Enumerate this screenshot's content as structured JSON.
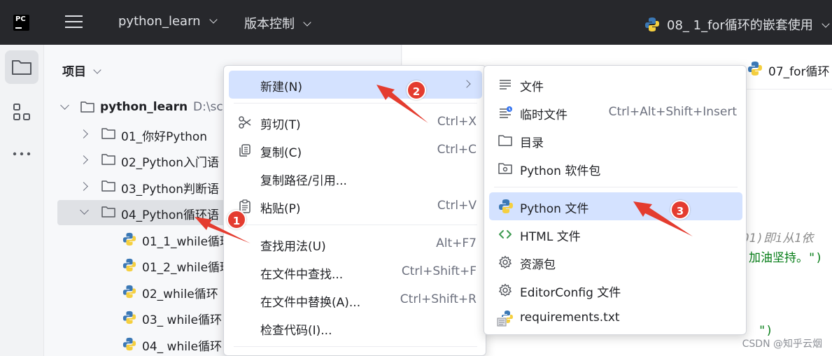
{
  "titlebar": {
    "logo_text": "PC",
    "project_name": "python_learn",
    "vcs_label": "版本控制",
    "run_config": "08_ 1_for循环的嵌套使用"
  },
  "project_panel": {
    "title": "项目",
    "root": {
      "name": "python_learn",
      "path": "D:\\sc"
    },
    "folders": [
      {
        "label": "01_你好Python",
        "expanded": false
      },
      {
        "label": "02_Python入门语",
        "expanded": false
      },
      {
        "label": "03_Python判断语",
        "expanded": false
      },
      {
        "label": "04_Python循环语",
        "expanded": true
      }
    ],
    "files": [
      "01_1_while循环",
      "01_2_while循环",
      "02_while循环",
      "03_ while循环",
      "04_ while循环"
    ]
  },
  "editor": {
    "tabs": [
      "07_for循环"
    ],
    "code_fragments": [
      ".01)即i从1依",
      "加油坚持。\")",
      "\")"
    ]
  },
  "context_menu": {
    "items": [
      {
        "label": "新建(N)",
        "mnemonic": "N",
        "shortcut": "",
        "submenu": true,
        "highlighted": true
      },
      {
        "label": "剪切(T)",
        "mnemonic": "T",
        "shortcut": "Ctrl+X",
        "icon": "scissors-icon"
      },
      {
        "label": "复制(C)",
        "mnemonic": "C",
        "shortcut": "Ctrl+C",
        "icon": "copy-icon"
      },
      {
        "label": "复制路径/引用...",
        "shortcut": ""
      },
      {
        "label": "粘贴(P)",
        "mnemonic": "P",
        "shortcut": "Ctrl+V",
        "icon": "paste-icon"
      },
      {
        "label": "查找用法(U)",
        "mnemonic": "U",
        "shortcut": "Alt+F7"
      },
      {
        "label": "在文件中查找...",
        "shortcut": "Ctrl+Shift+F"
      },
      {
        "label": "在文件中替换(A)...",
        "mnemonic": "A",
        "shortcut": "Ctrl+Shift+R"
      },
      {
        "label": "检查代码(I)...",
        "mnemonic": "I",
        "shortcut": ""
      }
    ]
  },
  "new_submenu": {
    "items": [
      {
        "label": "文件",
        "shortcut": "",
        "icon": "text-file-icon"
      },
      {
        "label": "临时文件",
        "shortcut": "Ctrl+Alt+Shift+Insert",
        "icon": "scratch-file-icon"
      },
      {
        "label": "目录",
        "shortcut": "",
        "icon": "folder-icon"
      },
      {
        "label": "Python 软件包",
        "shortcut": "",
        "icon": "package-icon"
      },
      {
        "label": "Python 文件",
        "shortcut": "",
        "icon": "python-icon",
        "highlighted": true
      },
      {
        "label": "HTML 文件",
        "shortcut": "",
        "icon": "html-icon"
      },
      {
        "label": "资源包",
        "shortcut": "",
        "icon": "gear-icon"
      },
      {
        "label": "EditorConfig 文件",
        "shortcut": "",
        "icon": "gear-icon"
      },
      {
        "label": "requirements.txt",
        "shortcut": "",
        "icon": "requirements-icon"
      }
    ]
  },
  "annotations": {
    "badges": [
      "1",
      "2",
      "3"
    ]
  },
  "watermark": "CSDN @知乎云烟",
  "colors": {
    "titlebar": "#27282c",
    "highlight": "#d4e2ff",
    "annotation_red": "#e43c2f",
    "python_blue": "#3b78b5",
    "python_yellow": "#f5cf3f"
  }
}
